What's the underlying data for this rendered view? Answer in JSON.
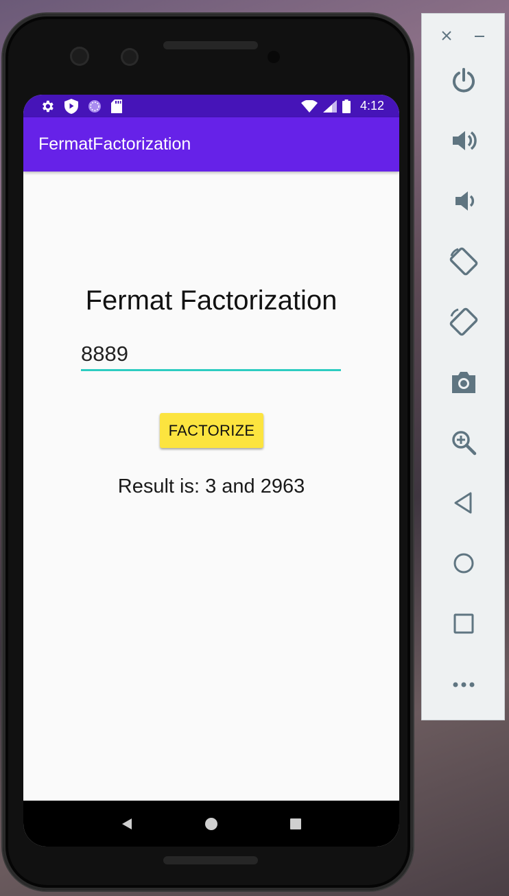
{
  "status_bar": {
    "time": "4:12"
  },
  "app_bar": {
    "title": "FermatFactorization"
  },
  "main": {
    "heading": "Fermat Factorization",
    "number_input_value": "8889",
    "factorize_button_label": "FACTORIZE",
    "result_text": "Result is: 3 and 2963"
  },
  "colors": {
    "status_bar": "#4614b8",
    "app_bar": "#6622e8",
    "input_underline": "#2dccc0",
    "button": "#fce43f",
    "panel_icons": "#5f7581"
  },
  "emulator_panel": {
    "window_controls": [
      "close-icon",
      "minimize-icon"
    ],
    "tools": [
      "power-icon",
      "volume-up-icon",
      "volume-down-icon",
      "rotate-left-icon",
      "rotate-right-icon",
      "camera-icon",
      "zoom-icon",
      "back-icon",
      "home-icon",
      "overview-icon",
      "more-icon"
    ]
  }
}
